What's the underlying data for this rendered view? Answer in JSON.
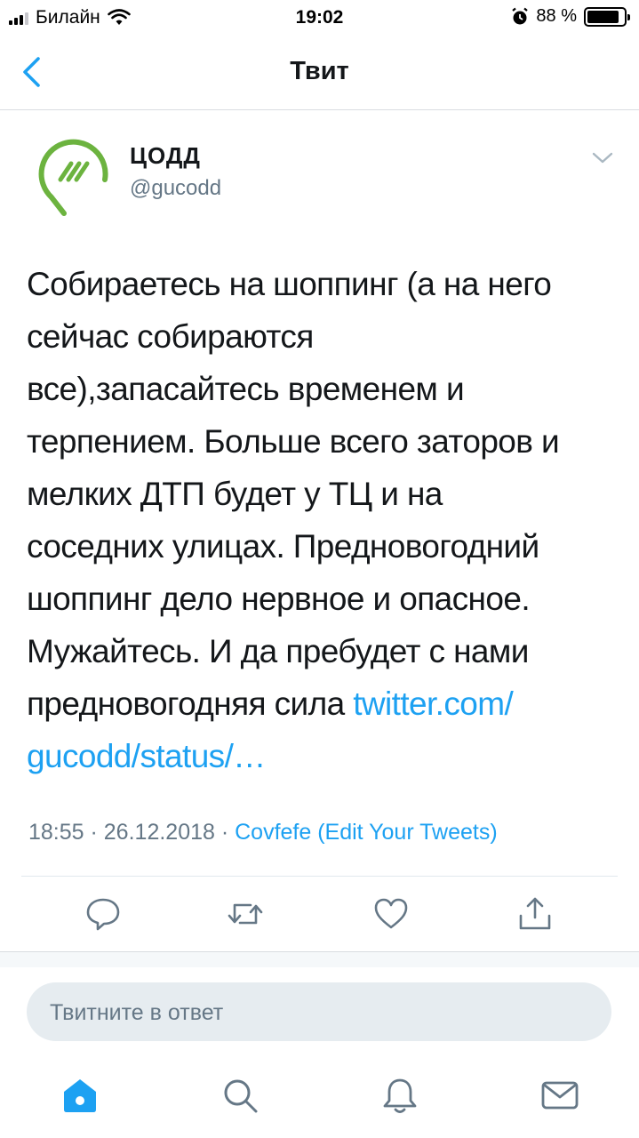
{
  "status_bar": {
    "carrier": "Билайн",
    "time": "19:02",
    "battery_percent": "88 %",
    "battery_level": 0.88,
    "icons": [
      "signal-icon",
      "wifi-icon",
      "alarm-icon",
      "battery-icon"
    ]
  },
  "nav": {
    "title": "Твит",
    "back_icon": "chevron-left-icon"
  },
  "tweet": {
    "author_name": "ЦОДД",
    "author_handle": "@gucodd",
    "text_lines": [
      "Собираетесь на шоппинг (а на него",
      "сейчас собираются",
      "все),запасайтесь временем и",
      "терпением. Больше всего заторов и",
      "мелких ДТП будет у ТЦ и на",
      "соседних улицах. Предновогодний",
      "шоппинг дело нервное и опасное.",
      "Мужайтесь. И да пребудет с нами"
    ],
    "text_last_prefix": "предновогодняя сила ",
    "link_part1": "twitter.com/",
    "link_part2": "gucodd/status/…",
    "time": "18:55",
    "separator1": " · ",
    "date": "26.12.2018",
    "separator2": " · ",
    "source": "Covfefe (Edit Your Tweets)"
  },
  "actions": [
    "reply-icon",
    "retweet-icon",
    "like-icon",
    "share-icon"
  ],
  "reply": {
    "placeholder": "Твитните в ответ"
  },
  "tabbar": [
    "home-icon",
    "search-icon",
    "notifications-icon",
    "messages-icon"
  ],
  "colors": {
    "accent": "#1da1f2",
    "secondary_text": "#657786",
    "logo_green": "#6cb33f"
  }
}
